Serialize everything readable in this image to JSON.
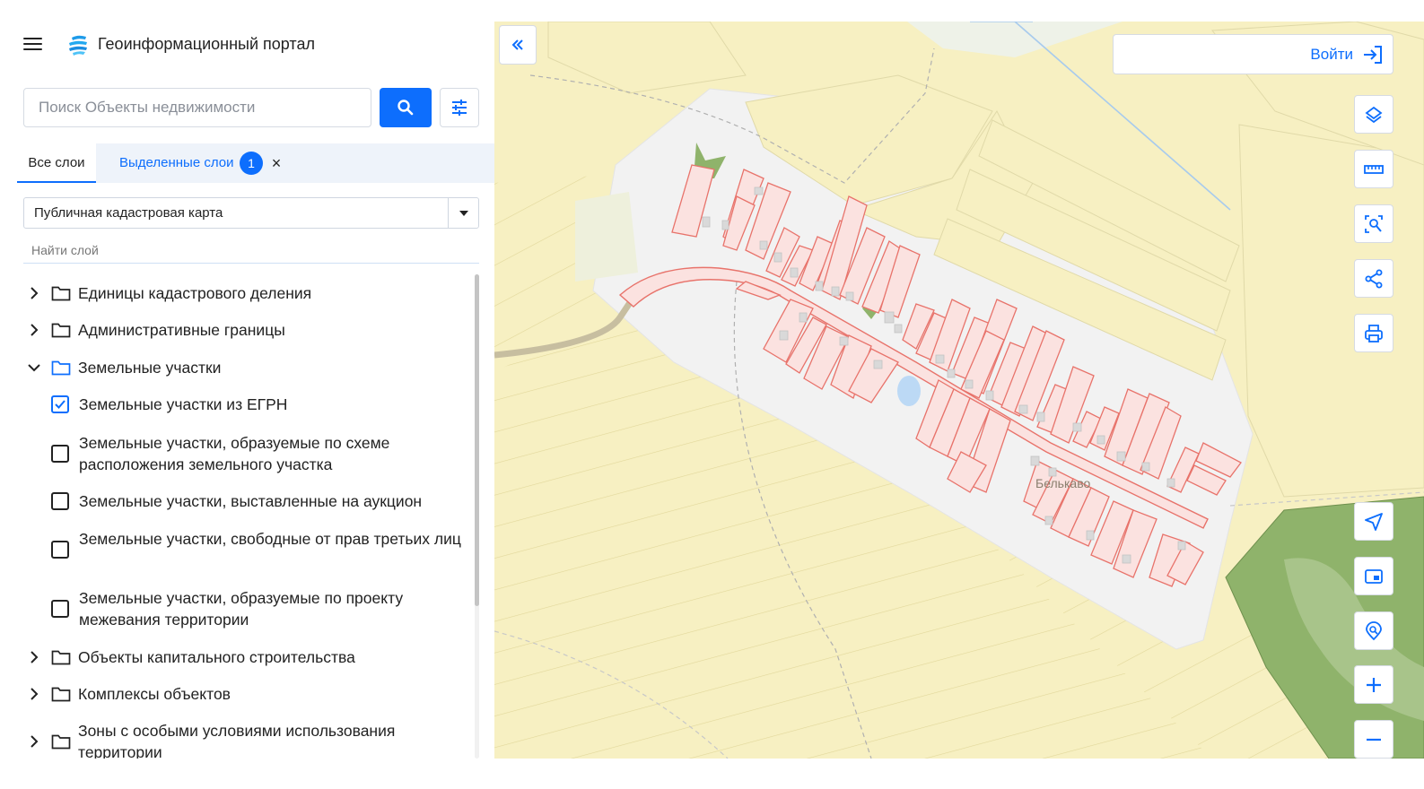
{
  "header": {
    "title": "Геоинформационный портал"
  },
  "search": {
    "placeholder": "Поиск Объекты недвижимости"
  },
  "tabs": {
    "all_label": "Все слои",
    "selected_label": "Выделенные слои",
    "selected_count": "1",
    "close_glyph": "×"
  },
  "map_select": {
    "value": "Публичная кадастровая карта"
  },
  "layer_search": {
    "placeholder": "Найти слой"
  },
  "tree": {
    "items": [
      {
        "label": "Единицы кадастрового деления",
        "type": "folder",
        "expanded": false
      },
      {
        "label": "Административные границы",
        "type": "folder",
        "expanded": false
      },
      {
        "label": "Земельные участки",
        "type": "folder",
        "expanded": true
      },
      {
        "label": "Земельные участки из ЕГРН",
        "type": "checkbox",
        "checked": true
      },
      {
        "label": "Земельные участки, образуемые по схеме расположения земельного участка",
        "type": "checkbox",
        "checked": false
      },
      {
        "label": "Земельные участки, выставленные на аукцион",
        "type": "checkbox",
        "checked": false
      },
      {
        "label": "Земельные участки, свободные от прав третьих лиц",
        "type": "checkbox",
        "checked": false
      },
      {
        "label": "Земельные участки, образуемые по проекту межевания территории",
        "type": "checkbox",
        "checked": false
      },
      {
        "label": "Объекты капитального строительства",
        "type": "folder",
        "expanded": false
      },
      {
        "label": "Комплексы объектов",
        "type": "folder",
        "expanded": false
      },
      {
        "label": "Зоны с особыми условиями использования территории",
        "type": "folder",
        "expanded": false
      }
    ]
  },
  "map": {
    "login_label": "Войти",
    "village_label": "Белькаво",
    "tools": [
      "layers-icon",
      "ruler-icon",
      "select-area-icon",
      "share-icon",
      "print-icon",
      "locate-icon",
      "minimap-icon",
      "geo-search-icon",
      "zoom-in-icon",
      "zoom-out-icon"
    ]
  },
  "colors": {
    "accent": "#0d6efd",
    "parcel_fill": "#fbe2e0",
    "parcel_stroke": "#e8736b",
    "field_fill": "#f7f0c2",
    "forest": "#8fb36b"
  }
}
